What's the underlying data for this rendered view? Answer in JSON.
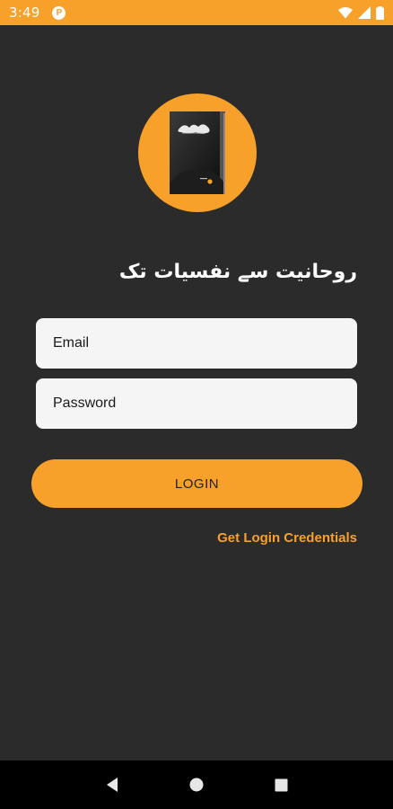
{
  "status_bar": {
    "time": "3:49",
    "app_icon": "P"
  },
  "header": {
    "title": "روحانیت سے نفسیات تک"
  },
  "form": {
    "email_placeholder": "Email",
    "password_placeholder": "Password",
    "login_label": "LOGIN",
    "credentials_link": "Get Login Credentials"
  },
  "icons": {
    "status": [
      "wifi-icon",
      "signal-icon",
      "battery-icon"
    ],
    "navigation": [
      "back-icon",
      "home-icon",
      "recents-icon"
    ]
  },
  "colors": {
    "accent": "#f7a12b",
    "background": "#2b2b2b",
    "field": "#f5f5f5"
  }
}
